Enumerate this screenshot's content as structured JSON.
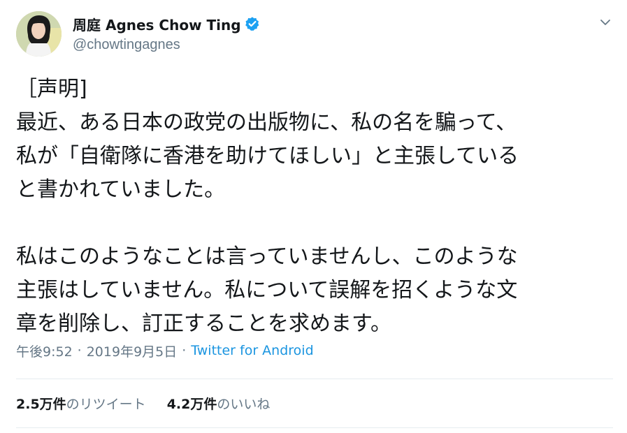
{
  "author": {
    "display_name": "周庭 Agnes Chow Ting",
    "handle": "@chowtingagnes",
    "verified": true,
    "avatar_icon": "profile-photo"
  },
  "tweet": {
    "lines": [
      "［声明]",
      "最近、ある日本の政党の出版物に、私の名を騙って、",
      "私が「自衛隊に香港を助けてほしい」と主張している",
      "と書かれていました。",
      "",
      "私はこのようなことは言っていませんし、このような",
      "主張はしていません。私について誤解を招くような文",
      "章を削除し、訂正することを求めます。"
    ],
    "time": "午後9:52",
    "date": "2019年9月5日",
    "separator": "·",
    "source": "Twitter for Android"
  },
  "stats": {
    "retweets": {
      "count": "2.5万件",
      "label": "のリツイート"
    },
    "likes": {
      "count": "4.2万件",
      "label": "のいいね"
    }
  },
  "colors": {
    "text": "#14171a",
    "secondary": "#657786",
    "link": "#1b95e0",
    "verified": "#1da1f2",
    "divider": "#e6ecf0"
  }
}
